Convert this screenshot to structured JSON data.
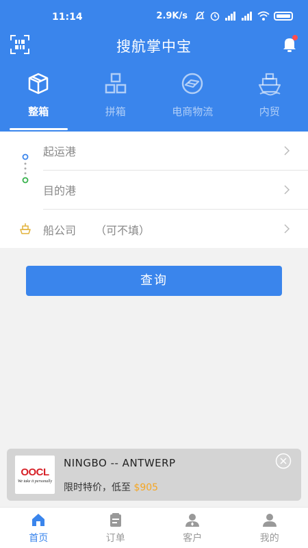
{
  "status_bar": {
    "time": "11:14",
    "speed": "2.9K/s"
  },
  "header": {
    "title": "搜航掌中宝"
  },
  "mode_tabs": [
    {
      "label": "整箱",
      "icon": "box-icon"
    },
    {
      "label": "拼箱",
      "icon": "grid-icon"
    },
    {
      "label": "电商物流",
      "icon": "parcel-icon"
    },
    {
      "label": "内贸",
      "icon": "ship-icon"
    }
  ],
  "active_mode": "整箱",
  "form": {
    "origin_placeholder": "起运港",
    "destination_placeholder": "目的港",
    "carrier_placeholder": "船公司",
    "carrier_hint": "（可不填）"
  },
  "query_label": "查询",
  "promo": {
    "logo_text": "OOCL",
    "logo_slogan": "We take it personally",
    "route": "NINGBO -- ANTWERP",
    "price_prefix": "限时特价，低至",
    "price": "$905"
  },
  "bottom_nav": [
    {
      "label": "首页",
      "icon": "home-icon"
    },
    {
      "label": "订单",
      "icon": "order-icon"
    },
    {
      "label": "客户",
      "icon": "customer-icon"
    },
    {
      "label": "我的",
      "icon": "profile-icon"
    }
  ],
  "active_nav": "首页",
  "colors": {
    "primary": "#3a85ec",
    "price": "#f5a623",
    "notification": "#ff4d4f",
    "origin_dot": "#3a85ec",
    "destination_dot": "#35b14a",
    "carrier_icon": "#e2b23a"
  }
}
